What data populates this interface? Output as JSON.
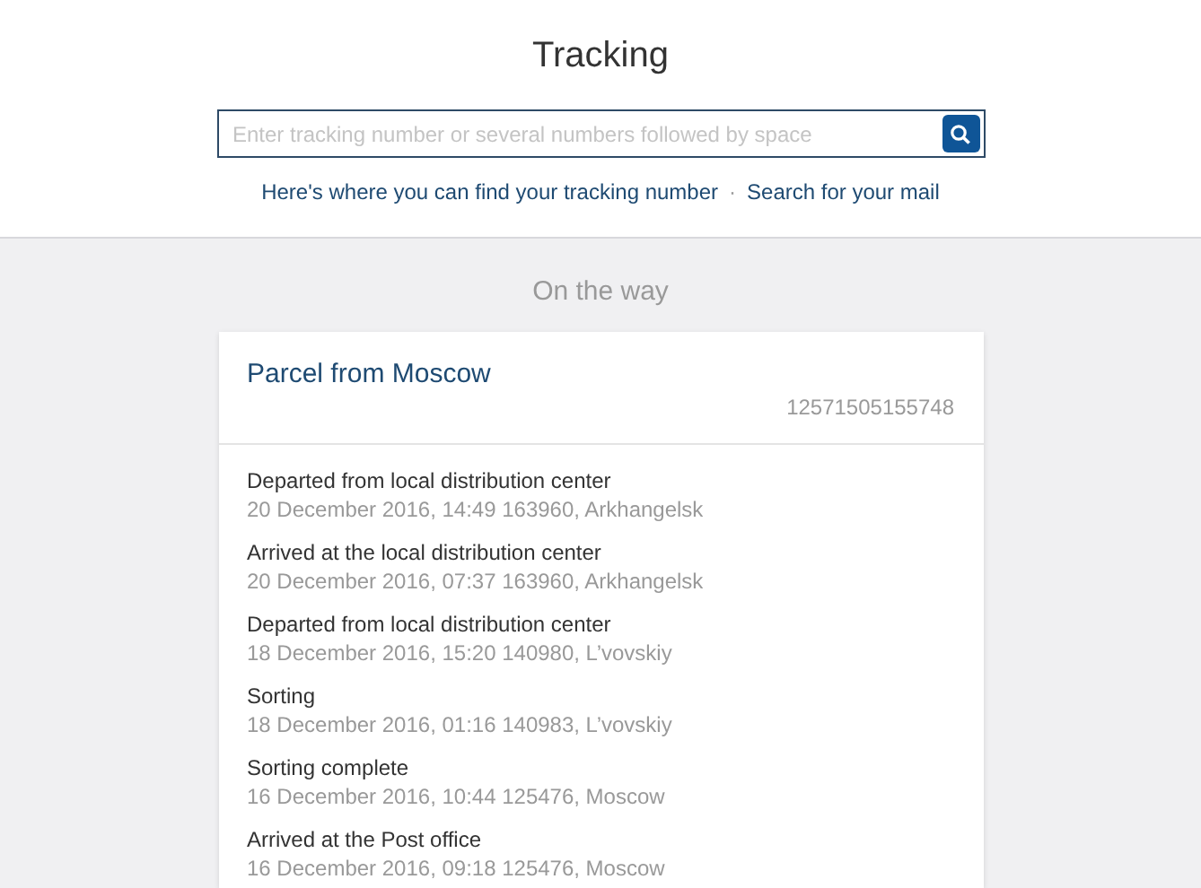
{
  "title": "Tracking",
  "search": {
    "placeholder": "Enter tracking number or several numbers followed by space"
  },
  "links": [
    {
      "label": "Here's where you can find your tracking number"
    },
    {
      "label": "·",
      "kind": "separator"
    },
    {
      "label": "Search for your mail"
    }
  ],
  "section_title": "On the way",
  "parcel": {
    "title": "Parcel from Moscow",
    "tracking_number": "12571505155748",
    "events": [
      {
        "status": "Departed from local distribution center",
        "details": "20 December 2016, 14:49 163960, Arkhangelsk"
      },
      {
        "status": "Arrived at the local distribution center",
        "details": "20 December 2016, 07:37 163960, Arkhangelsk"
      },
      {
        "status": "Departed from local distribution center",
        "details": "18 December 2016, 15:20 140980, L’vovskiy"
      },
      {
        "status": "Sorting",
        "details": "18 December 2016, 01:16 140983, L’vovskiy"
      },
      {
        "status": "Sorting complete",
        "details": "16 December 2016, 10:44 125476, Moscow"
      },
      {
        "status": "Arrived at the Post office",
        "details": "16 December 2016, 09:18 125476, Moscow"
      }
    ]
  }
}
